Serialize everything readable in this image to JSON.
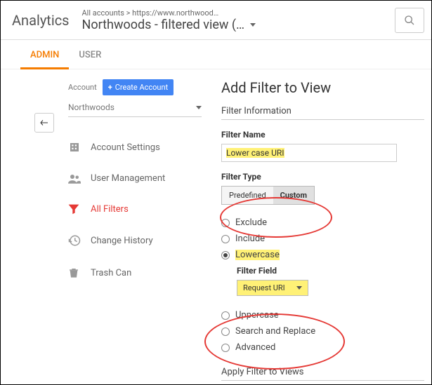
{
  "header": {
    "logo": "Analytics",
    "breadcrumb": "All accounts > https://www.northwood…",
    "view": "Northwoods - filtered view (…"
  },
  "tabs": {
    "admin": "ADMIN",
    "user": "USER"
  },
  "account": {
    "label": "Account",
    "create": "Create Account",
    "selected": "Northwoods"
  },
  "menu": {
    "settings": "Account Settings",
    "user_mgmt": "User Management",
    "all_filters": "All Filters",
    "change_history": "Change History",
    "trash": "Trash Can"
  },
  "panel": {
    "title": "Add Filter to View",
    "info": "Filter Information",
    "name_label": "Filter Name",
    "name_value": "Lower case URI",
    "type_label": "Filter Type",
    "type_predef": "Predefined",
    "type_custom": "Custom",
    "opts": {
      "exclude": "Exclude",
      "include": "Include",
      "lowercase": "Lowercase",
      "uppercase": "Uppercase",
      "search_replace": "Search and Replace",
      "advanced": "Advanced"
    },
    "filter_field_label": "Filter Field",
    "filter_field_value": "Request URI",
    "apply": "Apply Filter to Views"
  }
}
